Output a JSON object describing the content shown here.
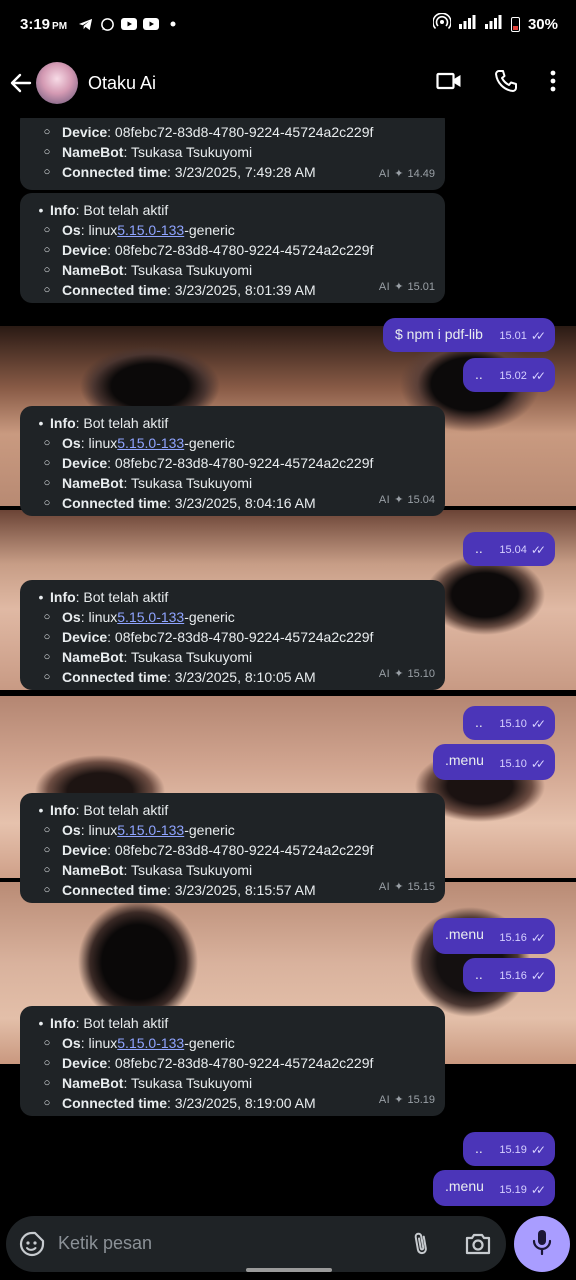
{
  "status_bar": {
    "time": "3:19",
    "ampm": "PM",
    "battery": "30%",
    "notification_icons": [
      "telegram-icon",
      "whatsapp-icon",
      "youtube-icon",
      "youtube-icon",
      "dot-icon"
    ]
  },
  "header": {
    "title": "Otaku Ai"
  },
  "messages": [
    {
      "dir": "in",
      "lines": [
        {
          "label": "Device",
          "value": ": 08febc72-83d8-4780-9224-45724a2c229f"
        },
        {
          "label": "NameBot",
          "value": ": Tsukasa Tsukuyomi"
        },
        {
          "label": "Connected time",
          "value": ": 3/23/2025, 7:49:28 AM"
        }
      ],
      "ai": "AI",
      "time": "14.49"
    },
    {
      "dir": "in",
      "info_label": "Info",
      "info_value": ": Bot telah aktif",
      "os_label": "Os",
      "os_prefix": ": linux ",
      "os_link": "5.15.0-133",
      "os_suffix": "-generic",
      "lines": [
        {
          "label": "Device",
          "value": ": 08febc72-83d8-4780-9224-45724a2c229f"
        },
        {
          "label": "NameBot",
          "value": ": Tsukasa Tsukuyomi"
        },
        {
          "label": "Connected time",
          "value": ": 3/23/2025, 8:01:39 AM"
        }
      ],
      "ai": "AI",
      "time": "15.01"
    },
    {
      "dir": "out",
      "text": "$ npm i pdf-lib",
      "time": "15.01"
    },
    {
      "dir": "out",
      "text": "..",
      "time": "15.02"
    },
    {
      "dir": "in",
      "info_label": "Info",
      "info_value": ": Bot telah aktif",
      "os_label": "Os",
      "os_prefix": ": linux ",
      "os_link": "5.15.0-133",
      "os_suffix": "-generic",
      "lines": [
        {
          "label": "Device",
          "value": ": 08febc72-83d8-4780-9224-45724a2c229f"
        },
        {
          "label": "NameBot",
          "value": ": Tsukasa Tsukuyomi"
        },
        {
          "label": "Connected time",
          "value": ": 3/23/2025, 8:04:16 AM"
        }
      ],
      "ai": "AI",
      "time": "15.04"
    },
    {
      "dir": "out",
      "text": "..",
      "time": "15.04"
    },
    {
      "dir": "in",
      "info_label": "Info",
      "info_value": ": Bot telah aktif",
      "os_label": "Os",
      "os_prefix": ": linux ",
      "os_link": "5.15.0-133",
      "os_suffix": "-generic",
      "lines": [
        {
          "label": "Device",
          "value": ": 08febc72-83d8-4780-9224-45724a2c229f"
        },
        {
          "label": "NameBot",
          "value": ": Tsukasa Tsukuyomi"
        },
        {
          "label": "Connected time",
          "value": ": 3/23/2025, 8:10:05 AM"
        }
      ],
      "ai": "AI",
      "time": "15.10"
    },
    {
      "dir": "out",
      "text": "..",
      "time": "15.10"
    },
    {
      "dir": "out",
      "text": ".menu",
      "time": "15.10"
    },
    {
      "dir": "in",
      "info_label": "Info",
      "info_value": ": Bot telah aktif",
      "os_label": "Os",
      "os_prefix": ": linux ",
      "os_link": "5.15.0-133",
      "os_suffix": "-generic",
      "lines": [
        {
          "label": "Device",
          "value": ": 08febc72-83d8-4780-9224-45724a2c229f"
        },
        {
          "label": "NameBot",
          "value": ": Tsukasa Tsukuyomi"
        },
        {
          "label": "Connected time",
          "value": ": 3/23/2025, 8:15:57 AM"
        }
      ],
      "ai": "AI",
      "time": "15.15"
    },
    {
      "dir": "out",
      "text": ".menu",
      "time": "15.16"
    },
    {
      "dir": "out",
      "text": "..",
      "time": "15.16"
    },
    {
      "dir": "in",
      "info_label": "Info",
      "info_value": ": Bot telah aktif",
      "os_label": "Os",
      "os_prefix": ": linux ",
      "os_link": "5.15.0-133",
      "os_suffix": "-generic",
      "lines": [
        {
          "label": "Device",
          "value": ": 08febc72-83d8-4780-9224-45724a2c229f"
        },
        {
          "label": "NameBot",
          "value": ": Tsukasa Tsukuyomi"
        },
        {
          "label": "Connected time",
          "value": ": 3/23/2025, 8:19:00 AM"
        }
      ],
      "ai": "AI",
      "time": "15.19"
    },
    {
      "dir": "out",
      "text": "..",
      "time": "15.19"
    },
    {
      "dir": "out",
      "text": ".menu",
      "time": "15.19"
    }
  ],
  "input": {
    "placeholder": "Ketik pesan"
  },
  "colors": {
    "incoming_bubble": "#1f2326",
    "outgoing_bubble": "#4b35b8",
    "link": "#8fa4ff",
    "mic_button": "#a99dff"
  }
}
